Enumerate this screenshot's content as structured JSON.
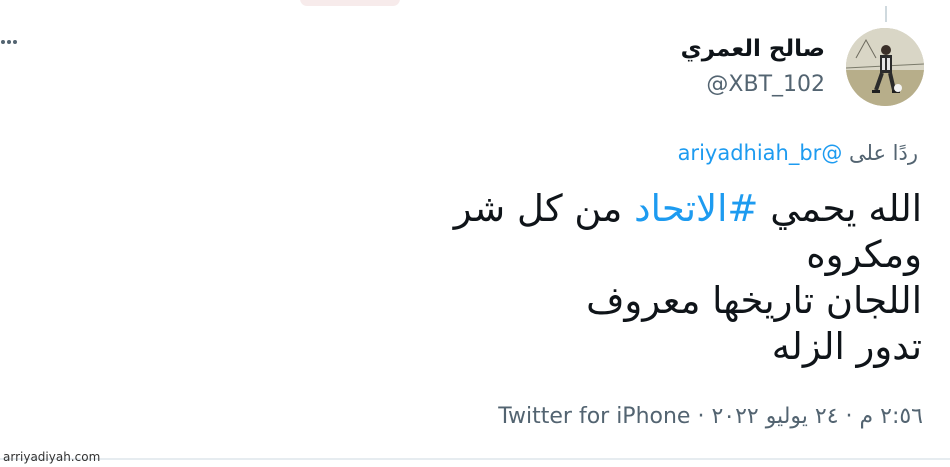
{
  "tweet": {
    "author": {
      "display_name": "صالح العمري",
      "handle": "@XBT_102",
      "avatar_icon": "player-photo-avatar"
    },
    "reply": {
      "prefix": "ردًا على",
      "mention": "@ariyadhiah_br"
    },
    "text": {
      "line1_start": "الله يحمي",
      "hashtag": "#الاتحاد",
      "line1_end": "من كل شر",
      "line2": "ومكروه",
      "line3": "اللجان تاريخها معروف",
      "line4": "تدور الزله"
    },
    "meta": {
      "time_date": "٢:٥٦ م · ٢٤ يوليو ٢٠٢٢ · ",
      "source": "Twitter for iPhone"
    }
  },
  "watermark": "arriyadiyah.com",
  "colors": {
    "link_blue": "#1d9bf0",
    "secondary_gray": "#536471"
  }
}
